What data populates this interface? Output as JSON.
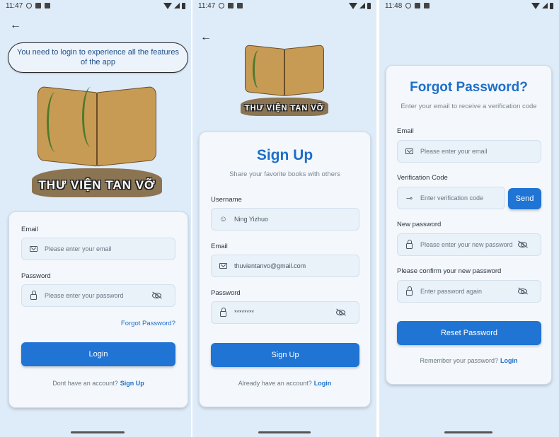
{
  "status_bar": [
    {
      "time": "11:47"
    },
    {
      "time": "11:47"
    },
    {
      "time": "11:48"
    }
  ],
  "logo_text": "THƯ VIỆN TAN VỠ",
  "login": {
    "banner": "You need to login to experience all the features of the app",
    "email_label": "Email",
    "email_placeholder": "Please enter your email",
    "password_label": "Password",
    "password_placeholder": "Please enter your password",
    "forgot_link": "Forgot Password?",
    "submit": "Login",
    "footer_text": "Dont have an account?",
    "footer_link": "Sign Up"
  },
  "signup": {
    "title": "Sign Up",
    "subtitle": "Share your favorite books with others",
    "username_label": "Username",
    "username_value": "Ning Yizhuo",
    "email_label": "Email",
    "email_value": "thuvientanvo@gmail.com",
    "password_label": "Password",
    "password_value": "********",
    "submit": "Sign Up",
    "footer_text": "Already have an account?",
    "footer_link": "Login"
  },
  "forgot": {
    "title": "Forgot Password?",
    "subtitle": "Enter your email to receive a verification code",
    "email_label": "Email",
    "email_placeholder": "Please enter your email",
    "code_label": "Verification Code",
    "code_placeholder": "Enter verification code",
    "send_button": "Send",
    "new_password_label": "New password",
    "new_password_placeholder": "Please enter your new password",
    "confirm_label": "Please confirm your new password",
    "confirm_placeholder": "Enter password again",
    "submit": "Reset Password",
    "footer_text": "Remember your password?",
    "footer_link": "Login"
  }
}
